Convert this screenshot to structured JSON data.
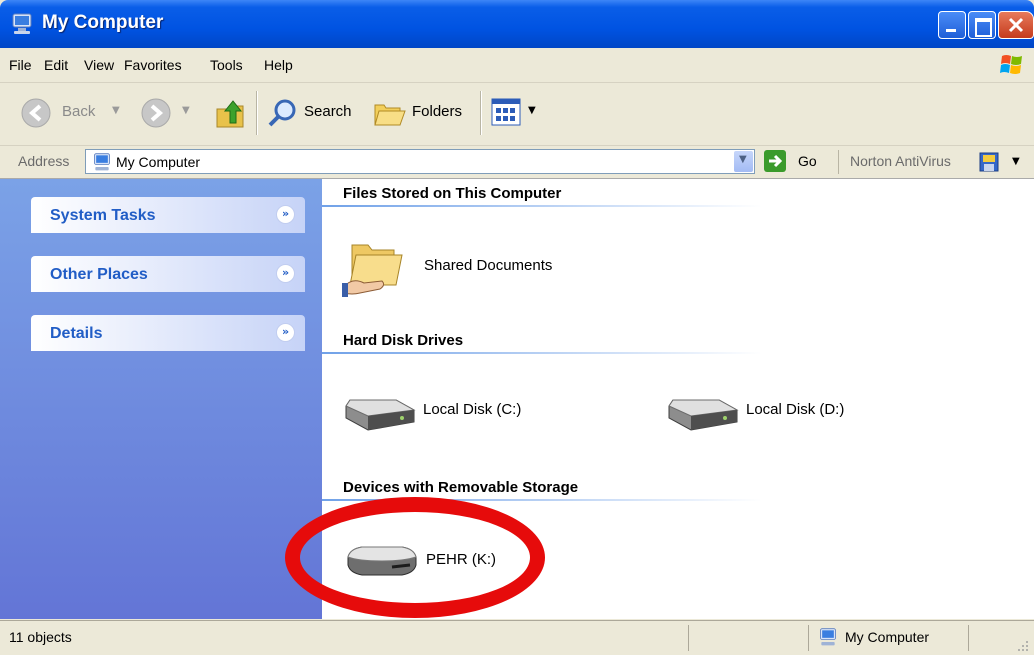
{
  "window": {
    "title": "My Computer"
  },
  "menu": {
    "items": [
      "File",
      "Edit",
      "View",
      "Favorites",
      "Tools",
      "Help"
    ]
  },
  "toolbar": {
    "back_label": "Back",
    "search_label": "Search",
    "folders_label": "Folders"
  },
  "address": {
    "label": "Address",
    "value": "My Computer",
    "go_label": "Go",
    "norton_label": "Norton AntiVirus"
  },
  "sidebar": {
    "panels": [
      {
        "label": "System Tasks"
      },
      {
        "label": "Other Places"
      },
      {
        "label": "Details"
      }
    ]
  },
  "content": {
    "groups": [
      {
        "heading": "Files Stored on This Computer",
        "items": [
          {
            "label": "Shared Documents",
            "icon": "shared-folder-icon"
          }
        ]
      },
      {
        "heading": "Hard Disk Drives",
        "items": [
          {
            "label": "Local Disk (C:)",
            "icon": "hard-drive-icon"
          },
          {
            "label": "Local Disk (D:)",
            "icon": "hard-drive-icon"
          }
        ]
      },
      {
        "heading": "Devices with Removable Storage",
        "items": [
          {
            "label": "PEHR (K:)",
            "icon": "removable-drive-icon"
          }
        ]
      }
    ]
  },
  "status": {
    "left": "11 objects",
    "right": "My Computer"
  },
  "colors": {
    "title_bar": "#0053e2",
    "sidebar_bg": "#6f8edc",
    "highlight_oval": "#e60b0b"
  }
}
